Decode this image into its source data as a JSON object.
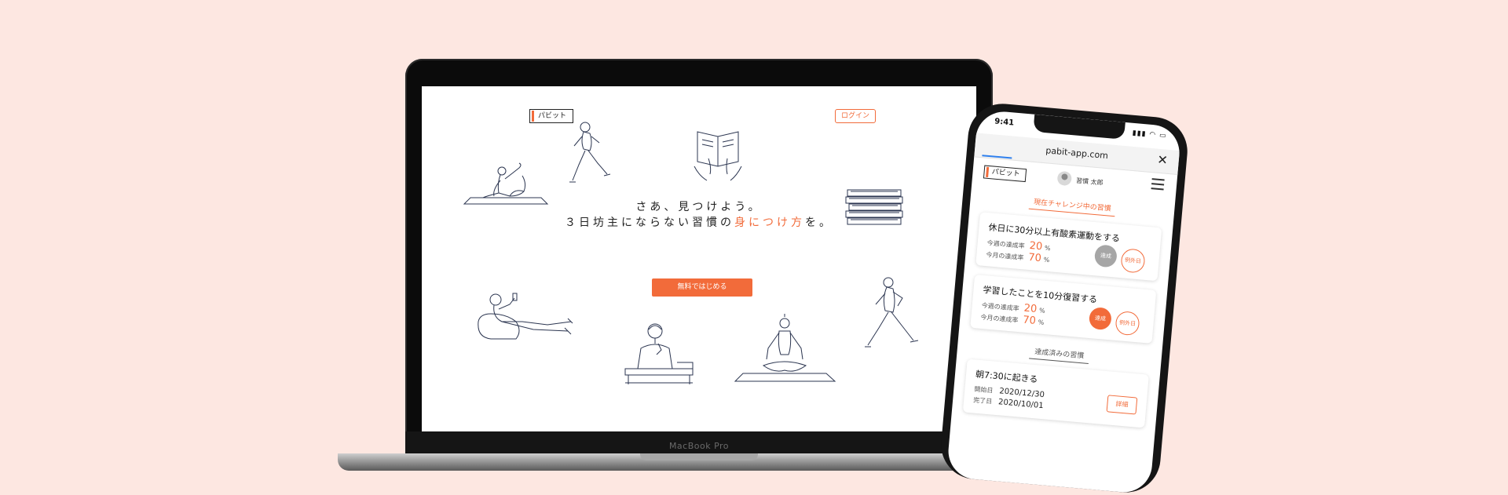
{
  "laptop": {
    "brand_label": "MacBook Pro",
    "site": {
      "logo": "パビット",
      "login_button": "ログイン",
      "headline_line1": "さあ、見つけよう。",
      "headline_line2_before": "３日坊主にならない習慣の",
      "headline_line2_accent": "身につけ方",
      "headline_line2_after": "を。",
      "cta_button": "無料ではじめる"
    }
  },
  "phone": {
    "status_time": "9:41",
    "url": "pabit-app.com",
    "logo": "パビット",
    "user_name": "習慣 太郎",
    "current_section_title": "現在チャレンジ中の習慣",
    "current_habits": [
      {
        "title": "休日に30分以上有酸素運動をする",
        "week_label": "今週の達成率",
        "week_value": "20",
        "month_label": "今月の達成率",
        "month_value": "70",
        "percent_sign": "%",
        "done_label": "達成",
        "exception_label": "例外日",
        "done_color": "#a6a6a6"
      },
      {
        "title": "学習したことを10分復習する",
        "week_label": "今週の達成率",
        "week_value": "20",
        "month_label": "今月の達成率",
        "month_value": "70",
        "percent_sign": "%",
        "done_label": "達成",
        "exception_label": "例外日",
        "done_color": "#f26b3a"
      }
    ],
    "achieved_section_title": "達成済みの習慣",
    "achieved_habits": [
      {
        "title": "朝7:30に起きる",
        "start_label": "開始日",
        "start_date": "2020/12/30",
        "end_label": "完了日",
        "end_date": "2020/10/01",
        "detail_button": "詳細"
      }
    ]
  },
  "colors": {
    "background": "#fde7e1",
    "accent": "#f26b3a"
  }
}
